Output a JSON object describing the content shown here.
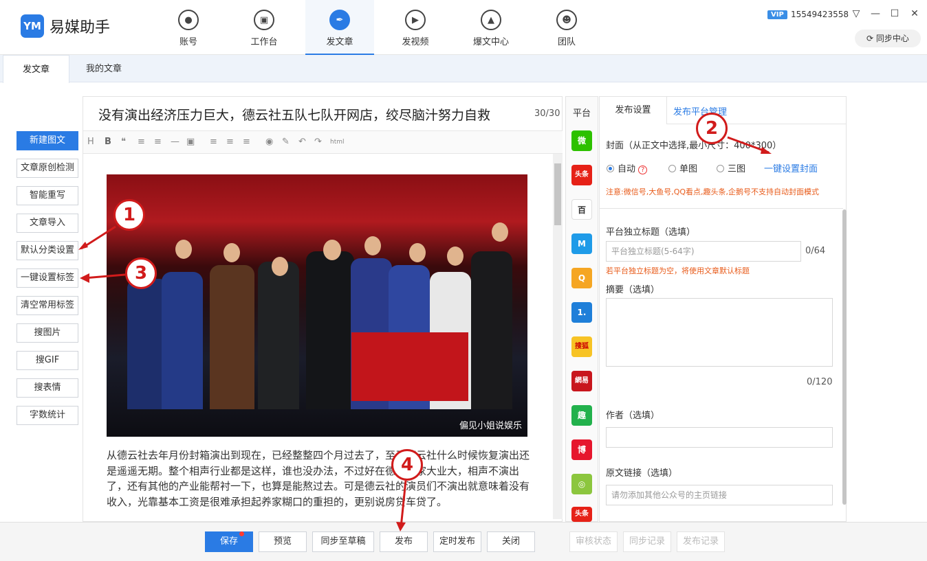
{
  "app": {
    "name": "易媒助手",
    "logo": "YM"
  },
  "nav": {
    "items": [
      {
        "label": "账号",
        "icon": "person-icon"
      },
      {
        "label": "工作台",
        "icon": "monitor-icon"
      },
      {
        "label": "发文章",
        "icon": "pen-icon",
        "active": true
      },
      {
        "label": "发视频",
        "icon": "play-icon"
      },
      {
        "label": "爆文中心",
        "icon": "flame-icon"
      },
      {
        "label": "团队",
        "icon": "team-icon"
      }
    ]
  },
  "user": {
    "vip": "VIP",
    "phone": "15549423558"
  },
  "sync_center": "同步中心",
  "subtabs": [
    "发文章",
    "我的文章"
  ],
  "left_buttons": [
    "新建图文",
    "文章原创检测",
    "智能重写",
    "文章导入",
    "默认分类设置",
    "一键设置标签",
    "清空常用标签",
    "搜图片",
    "搜GIF",
    "搜表情",
    "字数统计"
  ],
  "article": {
    "title": "没有演出经济压力巨大，德云社五队七队开网店，绞尽脑汁努力自救",
    "title_count": "30/30",
    "image_caption": "偏见小姐说娱乐",
    "body": "从德云社去年月份封箱演出到现在，已经整整四个月过去了，至于德云社什么时候恢复演出还是遥遥无期。整个相声行业都是这样，谁也没办法，不过好在德云社家大业大，相声不演出了，还有其他的产业能帮衬一下，也算是能熬过去。可是德云社的演员们不演出就意味着没有收入，光靠基本工资是很难承担起养家糊口的重担的，更别说房贷车贷了。"
  },
  "toolbar": {
    "html_label": "html"
  },
  "platforms": {
    "header": "平台",
    "items": [
      {
        "name": "微信",
        "label": "微",
        "color": "#2dc100"
      },
      {
        "name": "头条",
        "label": "头条",
        "color": "#e62117"
      },
      {
        "name": "百家",
        "label": "百",
        "color": "#ffffff"
      },
      {
        "name": "大鱼",
        "label": "M",
        "color": "#1f9be8"
      },
      {
        "name": "企鹅",
        "label": "Q",
        "color": "#f5a623"
      },
      {
        "name": "一点",
        "label": "1.",
        "color": "#1f7fd9"
      },
      {
        "name": "搜狐",
        "label": "搜狐",
        "color": "#f7c325"
      },
      {
        "name": "网易",
        "label": "網易",
        "color": "#c8161d"
      },
      {
        "name": "趣头条",
        "label": "趣",
        "color": "#22b14c"
      },
      {
        "name": "微博",
        "label": "博",
        "color": "#e6162d"
      },
      {
        "name": "简书",
        "label": "◎",
        "color": "#8cc63e"
      },
      {
        "name": "头条2",
        "label": "头条",
        "color": "#e62117"
      }
    ]
  },
  "right_panel": {
    "tab_settings": "发布设置",
    "tab_manage": "发布平台管理",
    "cover_label": "封面（从正文中选择,最小尺寸：400*300）",
    "cover_options": [
      "自动",
      "单图",
      "三图"
    ],
    "cover_one_key": "一键设置封面",
    "cover_note": "注意:微信号,大鱼号,QQ看点,趣头条,企鹅号不支持自动封面模式",
    "subtitle_label": "平台独立标题（选填）",
    "subtitle_placeholder": "平台独立标题(5-64字)",
    "subtitle_count": "0/64",
    "subtitle_note": "若平台独立标题为空，将使用文章默认标题",
    "summary_label": "摘要（选填）",
    "summary_count": "0/120",
    "author_label": "作者（选填）",
    "origin_label": "原文链接（选填）",
    "origin_placeholder": "请勿添加其他公众号的主页链接"
  },
  "bottom_buttons": {
    "save": "保存",
    "preview": "预览",
    "sync_draft": "同步至草稿",
    "publish": "发布",
    "scheduled": "定时发布",
    "close": "关闭",
    "review_status": "审核状态",
    "sync_record": "同步记录",
    "publish_record": "发布记录"
  },
  "annotations": [
    "1",
    "2",
    "3",
    "4"
  ],
  "colors": {
    "accent": "#2a7be4",
    "annotation": "#d11b1b",
    "warning": "#e85b1a"
  }
}
